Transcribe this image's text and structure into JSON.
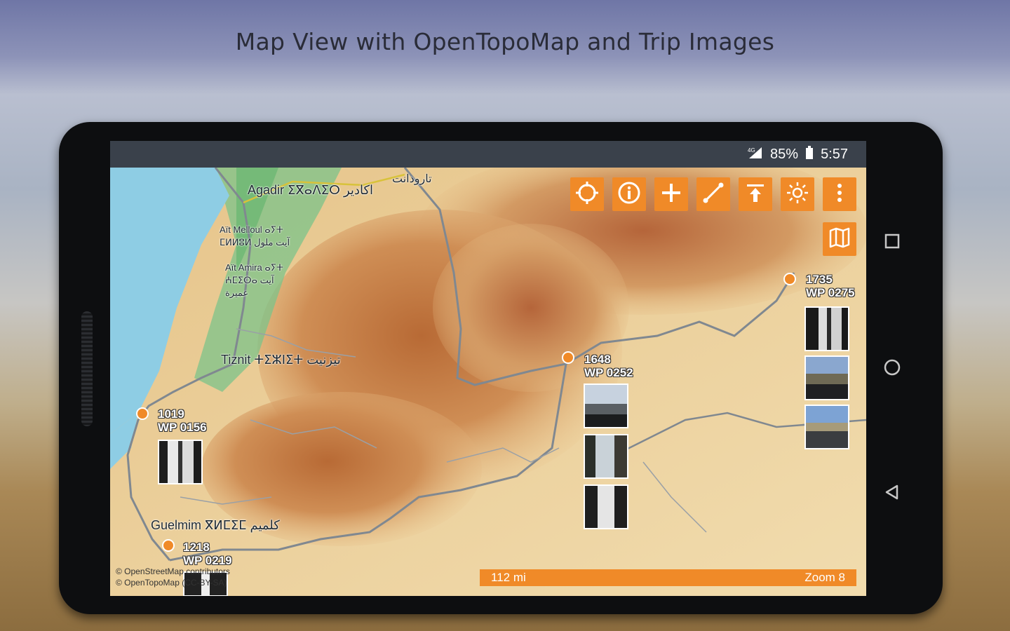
{
  "headline": "Map View with OpenTopoMap and Trip Images",
  "status": {
    "battery": "85%",
    "time": "5:57",
    "network": "4G"
  },
  "toolbar": {
    "buttons": [
      "target-icon",
      "info-icon",
      "plus-icon",
      "route-icon",
      "elevation-icon",
      "brightness-icon",
      "more-vert-icon"
    ]
  },
  "map_layer_button": "map-icon",
  "places": {
    "agadir": "Agadir ⵉⴳⴰⴷⵉⵔ اكادير",
    "taroudant": "تارودانت",
    "ait_melloul": "Aït Melloul ⴰⵢⵜ ⵎⵍⵍⵓⵍ آيت ملول",
    "ait_amira": "Aït Amira ⴰⵢⵜ ⵄⵎⵉⵔⴰ آيت عميرة",
    "tiznit": "Tiznit ⵜⵉⵣⵏⵉⵜ تيزنيت",
    "guelmim": "Guelmim ⴳⵍⵎⵉⵎ كلميم"
  },
  "waypoints": [
    {
      "elevation": "1019",
      "name": "WP 0156"
    },
    {
      "elevation": "1218",
      "name": "WP 0219"
    },
    {
      "elevation": "1648",
      "name": "WP 0252"
    },
    {
      "elevation": "1735",
      "name": "WP 0275"
    }
  ],
  "scale": {
    "distance": "112 mi",
    "zoom": "Zoom 8"
  },
  "attribution": {
    "line1": "© OpenStreetMap contributors",
    "line2": "© OpenTopoMap (CC-BY-SA)"
  },
  "colors": {
    "accent": "#f08a28",
    "statusbar": "#3a414b",
    "sea": "#8ecde4"
  }
}
